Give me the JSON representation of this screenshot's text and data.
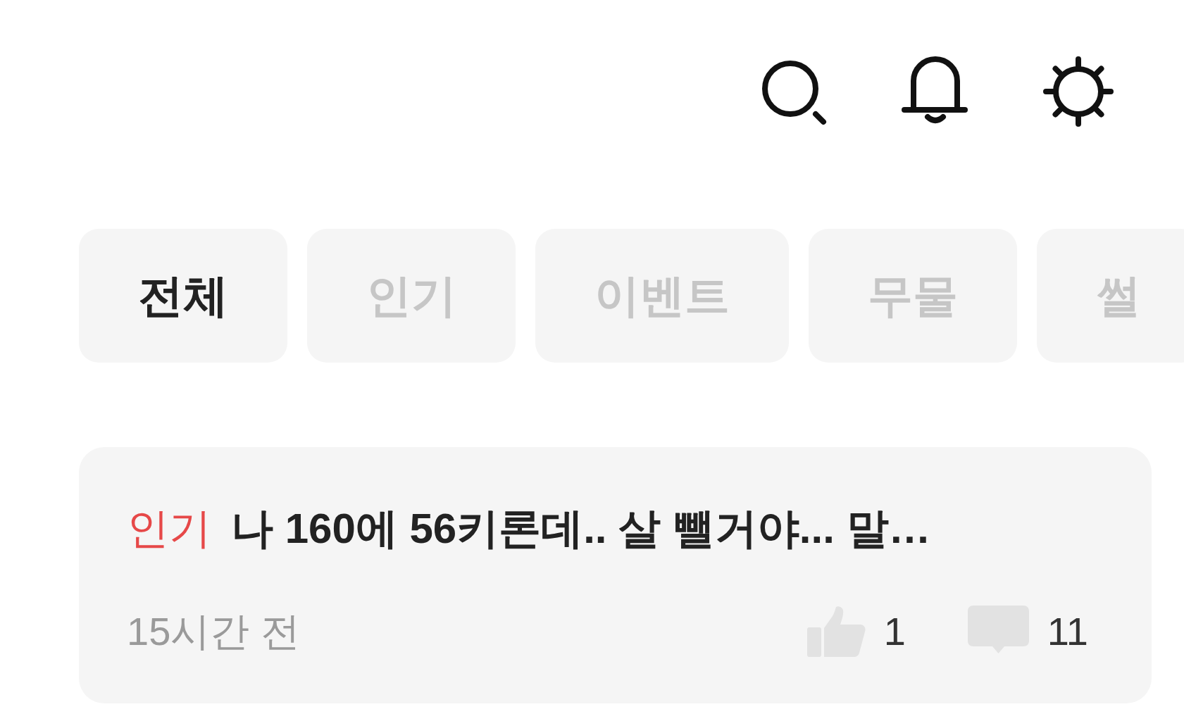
{
  "tabs": [
    {
      "label": "전체",
      "selected": true
    },
    {
      "label": "인기",
      "selected": false
    },
    {
      "label": "이벤트",
      "selected": false
    },
    {
      "label": "무물",
      "selected": false
    },
    {
      "label": "썰",
      "selected": false
    }
  ],
  "posts": [
    {
      "badge": "인기",
      "title": "나 160에 56키론데.. 살 뺄거야... 말…",
      "time": "15시간 전",
      "likes": "1",
      "comments": "11"
    }
  ]
}
